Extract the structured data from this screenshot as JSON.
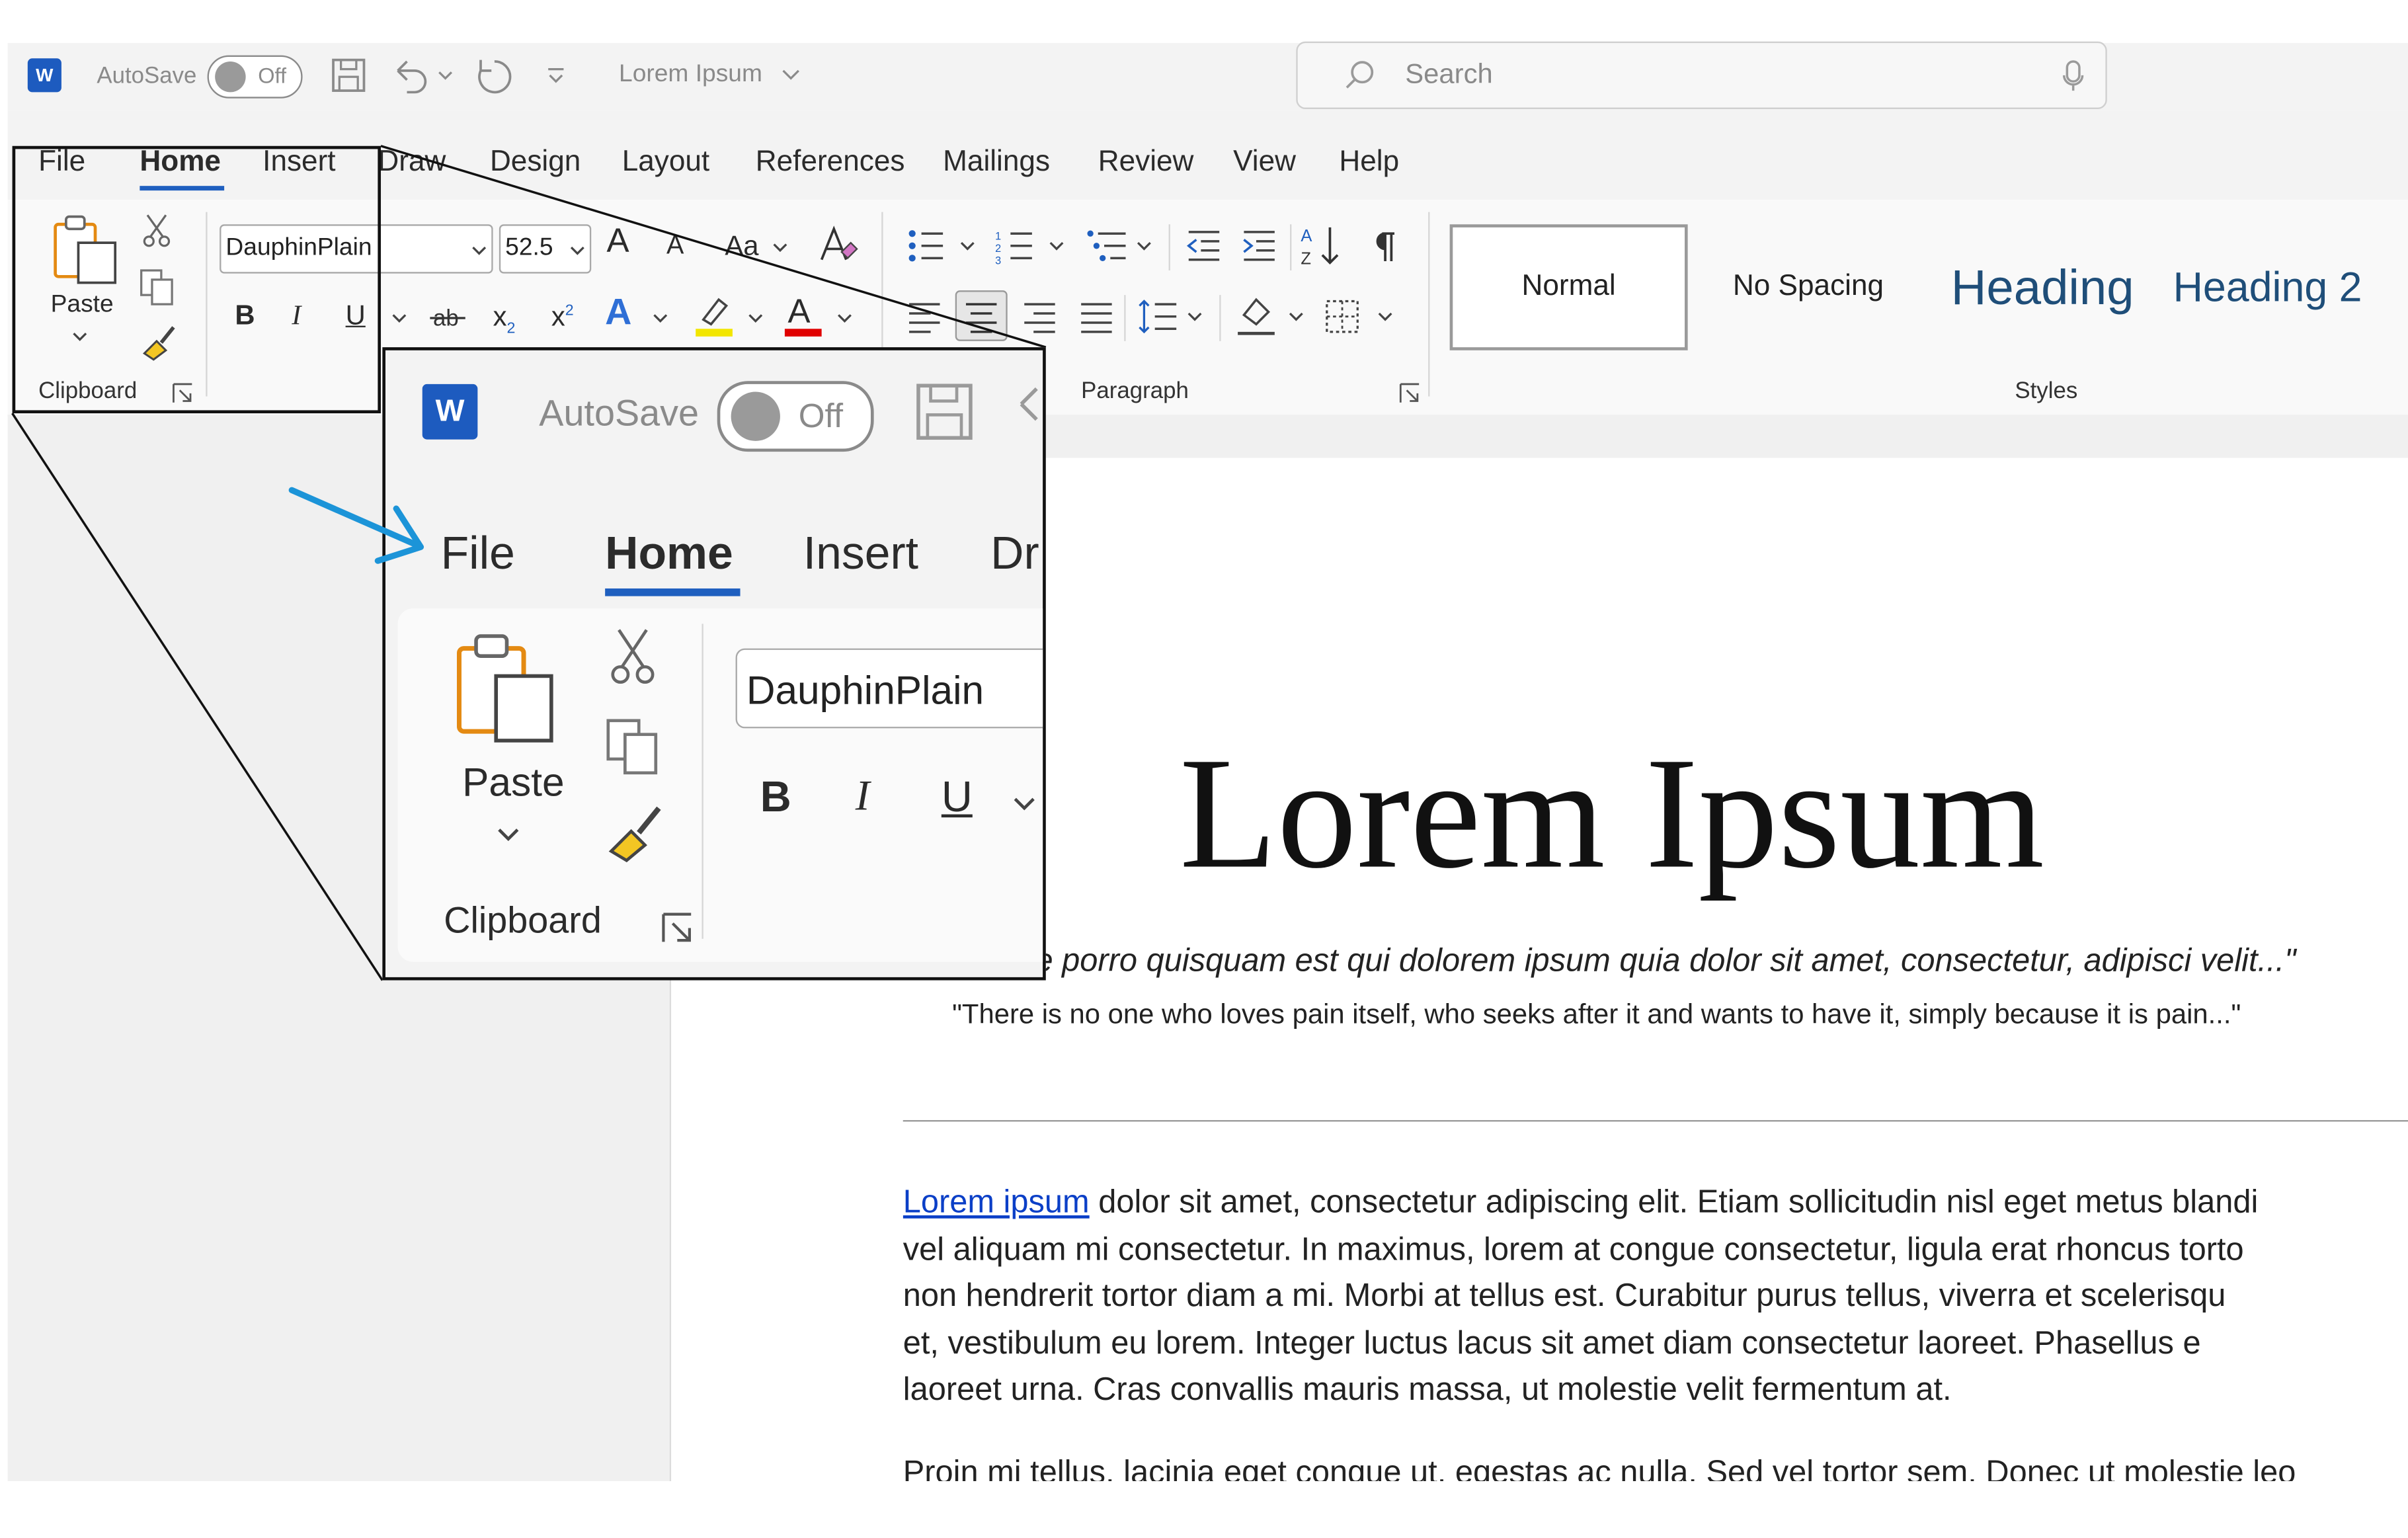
{
  "titlebar": {
    "app_logo": "W",
    "autosave_label": "AutoSave",
    "autosave_state": "Off",
    "doc_name": "Lorem Ipsum",
    "search_placeholder": "Search"
  },
  "menu": {
    "items": [
      "File",
      "Home",
      "Insert",
      "Draw",
      "Design",
      "Layout",
      "References",
      "Mailings",
      "Review",
      "View",
      "Help"
    ],
    "active": "Home"
  },
  "ribbon": {
    "clipboard": {
      "paste_label": "Paste",
      "group_label": "Clipboard"
    },
    "font": {
      "font_name": "DauphinPlain",
      "font_size": "52.5",
      "bold": "B",
      "italic": "I",
      "underline": "U",
      "subscript": "x",
      "sub_mark": "2",
      "superscript": "x",
      "sup_mark": "2",
      "grow": "A",
      "shrink": "A",
      "case": "Aa",
      "text_effect": "A",
      "font_color": "A"
    },
    "paragraph": {
      "group_label": "Paragraph"
    },
    "styles": {
      "group_label": "Styles",
      "items": [
        "Normal",
        "No Spacing",
        "Heading",
        "Heading 2"
      ]
    }
  },
  "zoom": {
    "autosave_label": "AutoSave",
    "autosave_state": "Off",
    "tabs": [
      "File",
      "Home",
      "Insert",
      "Dr"
    ],
    "paste_label": "Paste",
    "clipboard_label": "Clipboard",
    "font_name": "DauphinPlain",
    "bold": "B",
    "italic": "I",
    "underline": "U"
  },
  "document": {
    "title": "Lorem Ipsum",
    "quote_latin": "e porro quisquam est qui dolorem ipsum quia dolor sit amet, consectetur, adipisci velit...\"",
    "quote_english": "\"There is no one who loves pain itself, who seeks after it and wants to have it, simply because it is pain...\"",
    "link_text": "Lorem ipsum",
    "para1_line1": " dolor sit amet, consectetur adipiscing elit. Etiam sollicitudin nisl eget metus blandi",
    "para1_line2": "vel aliquam mi consectetur. In maximus, lorem at congue consectetur, ligula erat rhoncus torto",
    "para1_line3": "non hendrerit tortor diam a mi. Morbi at tellus est. Curabitur purus tellus, viverra et scelerisqu",
    "para1_line4": "et, vestibulum eu lorem. Integer luctus lacus sit amet diam consectetur laoreet. Phasellus e",
    "para1_line5": "laoreet urna. Cras convallis mauris massa, ut molestie velit fermentum at.",
    "para2_line1": "Proin mi tellus, lacinia eget congue ut, egestas ac nulla. Sed vel tortor sem. Donec ut molestie leo"
  },
  "colors": {
    "accent": "#1f5fbf",
    "arrow": "#1c94d8",
    "heading": "#1f4e79",
    "link": "#0b3fc7",
    "font_red": "#e00000",
    "highlight": "#f2e600"
  }
}
